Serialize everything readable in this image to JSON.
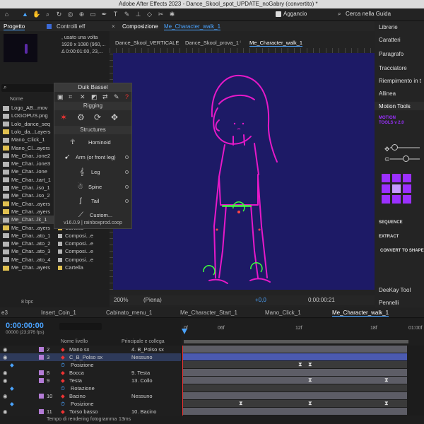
{
  "app": {
    "title": "Adobe After Effects 2023 - Dance_Skool_spot_UPDATE_noGabry (convertito) *",
    "snap_label": "Aggancio",
    "search_help": "Cerca nella Guida"
  },
  "project": {
    "tab_label": "Progetto",
    "effects_tab": "Controlli eff",
    "usage_line": ", usato una volta",
    "dims": "1920 x 1080  (960,...",
    "duration": "Δ 0:00:01:00, 23,...",
    "search_placeholder": "",
    "col_name": "Nome",
    "bpc": "8 bpc",
    "items": [
      {
        "name": "Logo_AB...mov",
        "type": "",
        "color": "#b5b5b5"
      },
      {
        "name": "LOGOPUS.png",
        "type": "",
        "color": "#b5b5b5"
      },
      {
        "name": "Lolo_dance_seq",
        "type": "",
        "color": "#b5b5b5"
      },
      {
        "name": "Lolo_da...Layers",
        "type": "",
        "color": "#e0c050"
      },
      {
        "name": "Mano_Click_1",
        "type": "",
        "color": "#b5b5b5"
      },
      {
        "name": "Mano_Cl...ayers",
        "type": "",
        "color": "#e0c050"
      },
      {
        "name": "Me_Char...ione2",
        "type": "",
        "color": "#b5b5b5"
      },
      {
        "name": "Me_Char...ione3",
        "type": "",
        "color": "#b5b5b5"
      },
      {
        "name": "Me_Char...ione",
        "type": "",
        "color": "#b5b5b5"
      },
      {
        "name": "Me_Char...tart_1",
        "type": "",
        "color": "#b5b5b5"
      },
      {
        "name": "Me_Char...iso_1",
        "type": "",
        "color": "#b5b5b5"
      },
      {
        "name": "Me_Char...iso_2",
        "type": "",
        "color": "#b5b5b5"
      },
      {
        "name": "Me_Char...ayers",
        "type": "Cartella",
        "color": "#e0c050"
      },
      {
        "name": "Me_Char...ayers",
        "type": "Cartella",
        "color": "#e0c050"
      },
      {
        "name": "Me_Char...lk_1",
        "type": "Composi...e",
        "color": "#b5b5b5"
      },
      {
        "name": "Me_Char...ayers",
        "type": "Cartella",
        "color": "#e0c050"
      },
      {
        "name": "Me_Char...ato_1",
        "type": "Composi...e",
        "color": "#b5b5b5"
      },
      {
        "name": "Me_Char...ato_2",
        "type": "Composi...e",
        "color": "#b5b5b5"
      },
      {
        "name": "Me_Char...ato_3",
        "type": "Composi...e",
        "color": "#b5b5b5"
      },
      {
        "name": "Me_Char...ato_4",
        "type": "Composi...e",
        "color": "#b5b5b5"
      },
      {
        "name": "Me_Char...ayers",
        "type": "Cartella",
        "color": "#e0c050"
      }
    ]
  },
  "duik": {
    "title": "Duik Bassel",
    "rigging": "Rigging",
    "structures": "Structures",
    "items": [
      "Hominoid",
      "Arm (or front leg)",
      "Leg",
      "Spine",
      "Tail",
      "Custom..."
    ],
    "version": "v16.0.9 | rainboxprod.coop"
  },
  "composition": {
    "label": "Composizione",
    "name": "Me_Character_walk_1",
    "breadcrumbs": [
      "Dance_Skool_VERTICALE",
      "Dance_Skool_prova_1",
      "Me_Character_walk_1"
    ],
    "zoom": "200%",
    "resolution": "(Piena)",
    "timecode": "0:00:00:21",
    "exposure": "+0,0",
    "canvas_color": "#1d1a66",
    "character_color": "#e619c8",
    "control_color": "#3cff3c"
  },
  "right_panel": {
    "items": [
      "Librerie",
      "Caratteri",
      "Paragrafo",
      "Tracciatore",
      "Riempimento in t",
      "Allinea",
      "Motion Tools",
      "DeeKay Tool",
      "Pennelli"
    ],
    "motion_tools": "MOTION TOOLS v 2.0",
    "sequence": "SEQUENCE",
    "extract": "EXTRACT",
    "convert": "CONVERT TO SHAPE",
    "accent": "#9b30ff"
  },
  "timeline": {
    "tabs": [
      "e3",
      "Insert_Coin_1",
      "Cabinato_menu_1",
      "Me_Character_Start_1",
      "Mano_Click_1",
      "Me_Character_walk_1"
    ],
    "current_time": "0:00:00:00",
    "frame_info": "00000 (23,976 fps)",
    "col_layer": "Nome livello",
    "col_parent": "Principale e collega",
    "ruler": [
      "0f",
      "06f",
      "12f",
      "18f",
      "01:00f"
    ],
    "render_time": "Tempo di rendering fotogramma",
    "render_value": "13ms",
    "layers": [
      {
        "num": "2",
        "name": "Mano sx",
        "parent": "4. B_Polso sx",
        "color": "#b47cd6"
      },
      {
        "num": "3",
        "name": "C_B_Polso sx",
        "parent": "Nessuno",
        "color": "#b47cd6"
      },
      {
        "num": "",
        "name": "Posizione",
        "parent": "",
        "color": ""
      },
      {
        "num": "8",
        "name": "Bocca",
        "parent": "9. Testa",
        "color": "#b47cd6"
      },
      {
        "num": "9",
        "name": "Testa",
        "parent": "13. Collo",
        "color": "#b47cd6"
      },
      {
        "num": "",
        "name": "Rotazione",
        "parent": "",
        "color": ""
      },
      {
        "num": "10",
        "name": "Bacino",
        "parent": "Nessuno",
        "color": "#b47cd6"
      },
      {
        "num": "",
        "name": "Posizione",
        "parent": "",
        "color": ""
      },
      {
        "num": "11",
        "name": "Torso basso",
        "parent": "10. Bacino",
        "color": "#b47cd6"
      }
    ]
  }
}
